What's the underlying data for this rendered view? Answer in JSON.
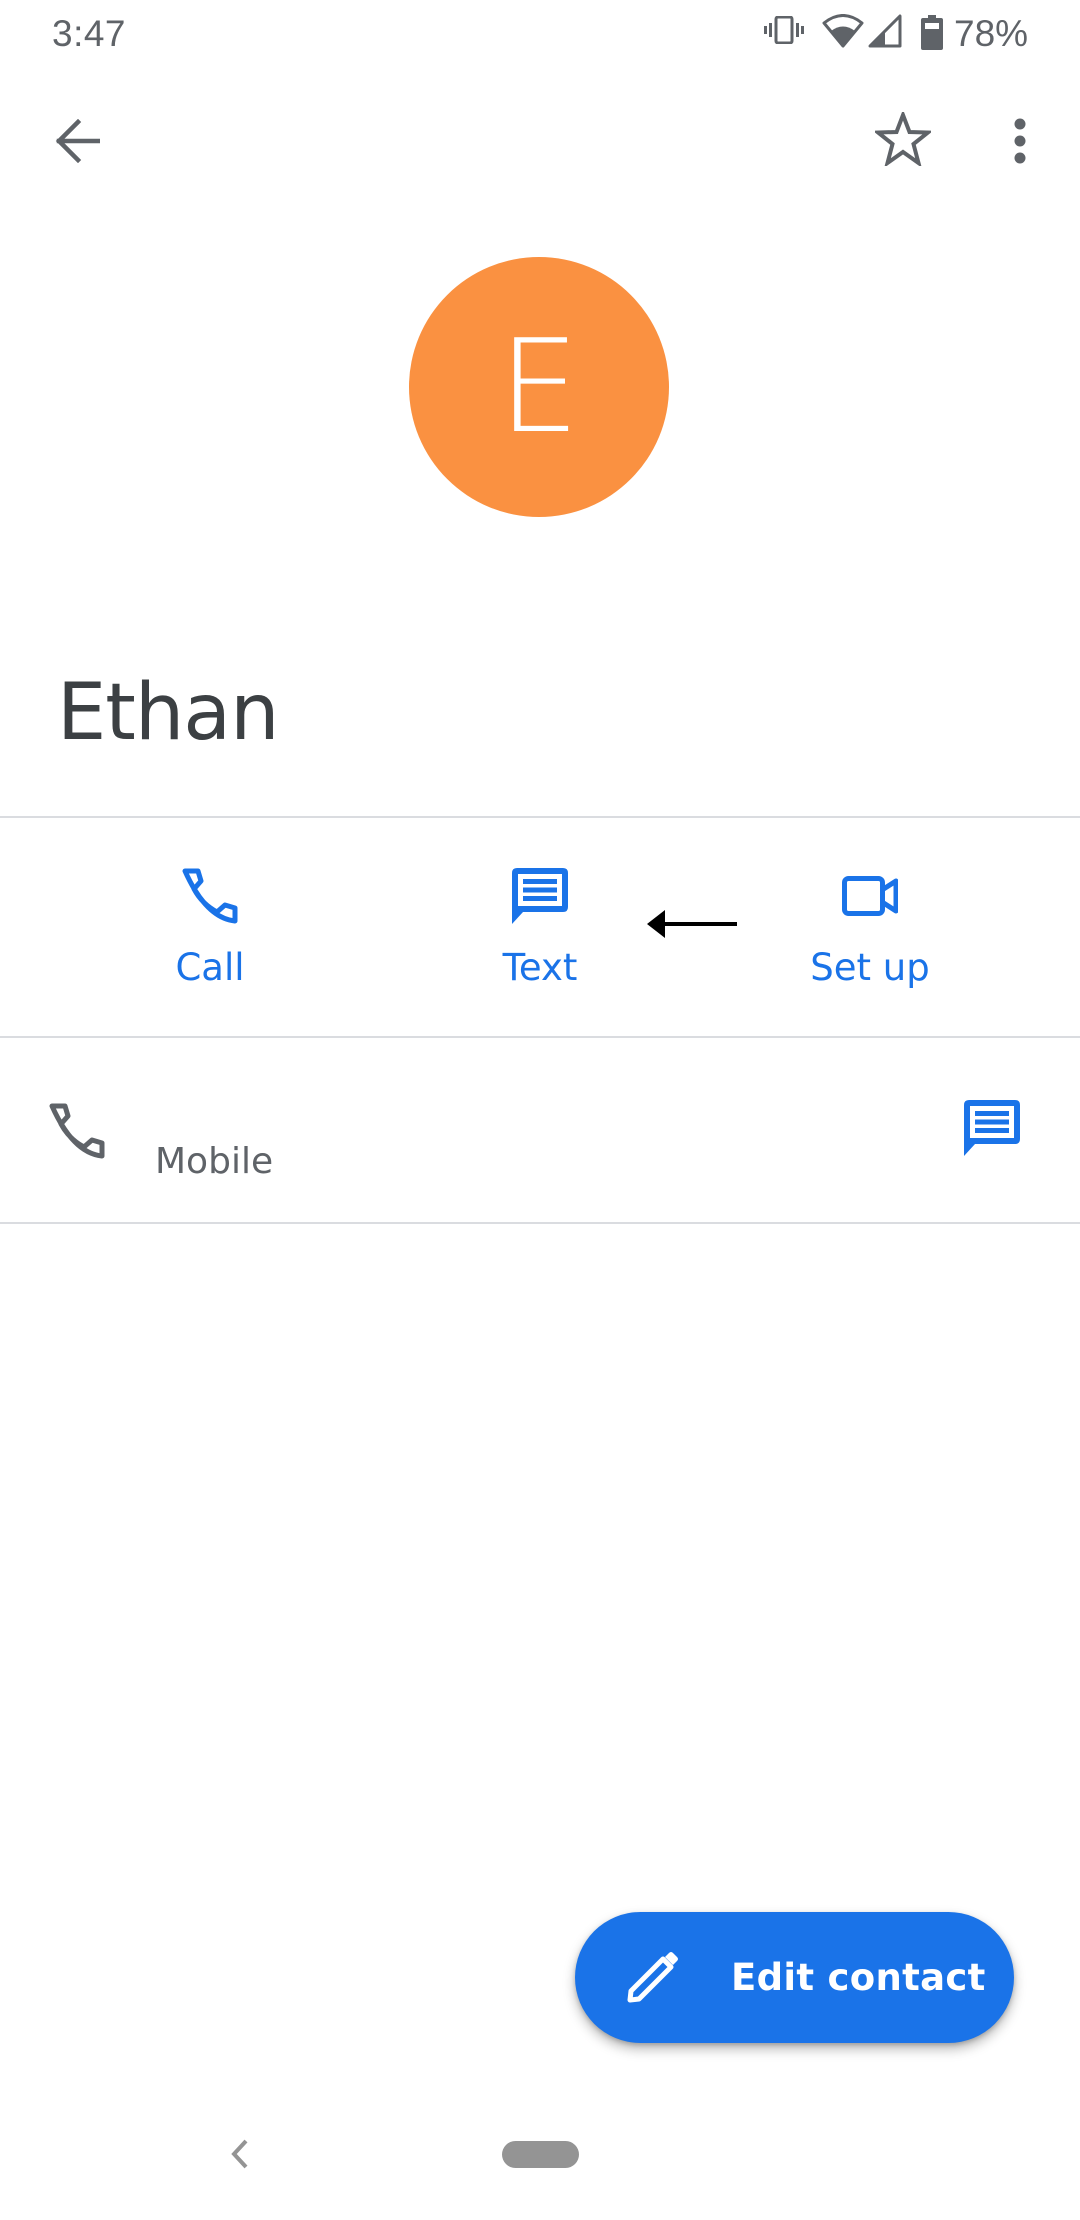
{
  "status_bar": {
    "time": "3:47",
    "battery_percent": "78%",
    "icons": [
      "vibrate-icon",
      "wifi-icon",
      "cell-signal-icon",
      "battery-icon"
    ]
  },
  "app_bar": {
    "back_icon": "arrow-back-icon",
    "favorite_icon": "star-outline-icon",
    "more_icon": "more-vert-icon"
  },
  "contact": {
    "initial": "E",
    "name": "Ethan",
    "avatar_color": "#fa9141"
  },
  "actions": [
    {
      "label": "Call",
      "icon": "phone-icon"
    },
    {
      "label": "Text",
      "icon": "message-icon"
    },
    {
      "label": "Set up",
      "icon": "videocam-icon"
    }
  ],
  "annotation": {
    "icon": "left-arrow-annotation"
  },
  "phone_entry": {
    "number": "",
    "type_label": "Mobile",
    "leading_icon": "phone-icon",
    "trailing_icon": "message-icon"
  },
  "fab": {
    "label": "Edit contact",
    "icon": "pencil-icon"
  },
  "nav_bar": {
    "back_icon": "nav-back-icon",
    "home_icon": "home-pill-icon"
  },
  "colors": {
    "accent": "#1a73e8",
    "icon_gray": "#5f6368",
    "divider": "#dadce0",
    "name_text": "#3c4043"
  }
}
